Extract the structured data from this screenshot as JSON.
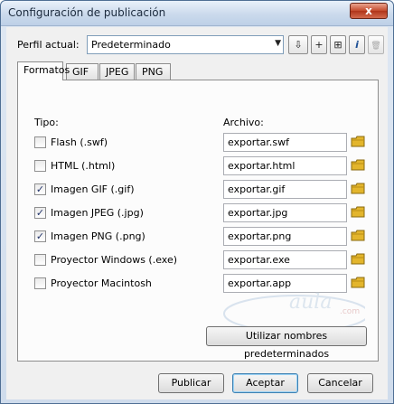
{
  "window": {
    "title": "Configuración de publicación",
    "close_label": "x"
  },
  "profile": {
    "label": "Perfil actual:",
    "selected": "Predeterminado",
    "toolbar": [
      "⇩",
      "+",
      "⊞",
      "i",
      "🗑"
    ]
  },
  "tabs": [
    {
      "label": "Formatos",
      "active": true
    },
    {
      "label": "GIF",
      "active": false
    },
    {
      "label": "JPEG",
      "active": false
    },
    {
      "label": "PNG",
      "active": false
    }
  ],
  "formats": {
    "type_header": "Tipo:",
    "file_header": "Archivo:",
    "rows": [
      {
        "label": "Flash  (.swf)",
        "checked": false,
        "file": "exportar.swf"
      },
      {
        "label": "HTML  (.html)",
        "checked": false,
        "file": "exportar.html"
      },
      {
        "label": "Imagen GIF  (.gif)",
        "checked": true,
        "file": "exportar.gif"
      },
      {
        "label": "Imagen JPEG  (.jpg)",
        "checked": true,
        "file": "exportar.jpg"
      },
      {
        "label": "Imagen PNG  (.png)",
        "checked": true,
        "file": "exportar.png"
      },
      {
        "label": "Proyector Windows (.exe)",
        "checked": false,
        "file": "exportar.exe"
      },
      {
        "label": "Proyector Macintosh",
        "checked": false,
        "file": "exportar.app"
      }
    ],
    "default_names_button": "Utilizar nombres predeterminados"
  },
  "watermark": {
    "text": "aula",
    "sub": ".com"
  },
  "buttons": {
    "publish": "Publicar",
    "accept": "Aceptar",
    "cancel": "Cancelar"
  },
  "colors": {
    "folder": "#e3b52c",
    "check": "#22346a"
  }
}
